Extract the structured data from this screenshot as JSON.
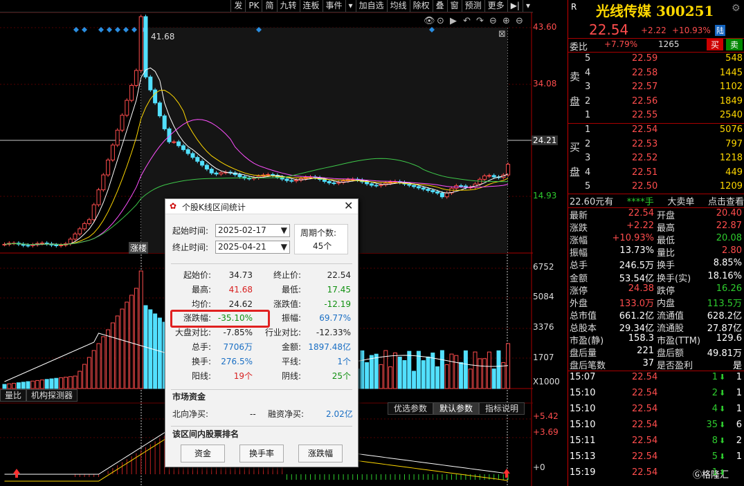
{
  "toolbar": {
    "items": [
      "发",
      "PK",
      "简",
      "九转",
      "连板",
      "事件",
      "▾",
      "加自选",
      "均线",
      "除权",
      "叠",
      "窗",
      "预测",
      "更多",
      "▶|",
      "▾"
    ]
  },
  "chart": {
    "price_axis": [
      "43.60",
      "34.08",
      "24.21",
      "14.93"
    ],
    "vol_axis": [
      "6752",
      "5084",
      "3376",
      "1707",
      "X1000"
    ],
    "ind_axis": [
      "+5.42",
      "+3.69",
      "+0"
    ],
    "peak_label": "41.68",
    "limitup_label": "涨楼",
    "subtabs": [
      "量比",
      "机构探测器"
    ],
    "param_tabs": [
      "优选参数",
      "默认参数",
      "指标说明"
    ]
  },
  "chart_data": {
    "type": "candlestick",
    "price_range": [
      9.5,
      43.6
    ],
    "marked_price": 24.21,
    "peak": 41.68
  },
  "quote": {
    "market": "R",
    "name": "光线传媒",
    "code": "300251",
    "price": "22.54",
    "change": "+2.22",
    "pct": "+10.93%",
    "tag": "陆",
    "weibi_label": "委比",
    "weibi": "+7.79%",
    "weicha": "1265",
    "buy_btn": "买",
    "sell_btn": "卖",
    "sell_side": "卖",
    "sell_side2": "盘",
    "buy_side": "买",
    "buy_side2": "盘",
    "asks": [
      {
        "lvl": "5",
        "price": "22.59",
        "vol": "548"
      },
      {
        "lvl": "4",
        "price": "22.58",
        "vol": "1445"
      },
      {
        "lvl": "3",
        "price": "22.57",
        "vol": "1102"
      },
      {
        "lvl": "2",
        "price": "22.56",
        "vol": "1849"
      },
      {
        "lvl": "1",
        "price": "22.55",
        "vol": "2540"
      }
    ],
    "bids": [
      {
        "lvl": "1",
        "price": "22.54",
        "vol": "5076"
      },
      {
        "lvl": "2",
        "price": "22.53",
        "vol": "797"
      },
      {
        "lvl": "3",
        "price": "22.52",
        "vol": "1218"
      },
      {
        "lvl": "4",
        "price": "22.51",
        "vol": "449"
      },
      {
        "lvl": "5",
        "price": "22.50",
        "vol": "1209"
      }
    ],
    "bigorder": {
      "a": "22.60元有",
      "b": "****手",
      "c": "大卖单",
      "d": "点击查看"
    },
    "stats": [
      [
        "最新",
        "22.54",
        "red",
        "开盘",
        "20.40",
        "red"
      ],
      [
        "涨跌",
        "+2.22",
        "red",
        "最高",
        "22.87",
        "red"
      ],
      [
        "涨幅",
        "+10.93%",
        "red",
        "最低",
        "20.08",
        "green"
      ],
      [
        "振幅",
        "13.73%",
        "white",
        "量比",
        "2.80",
        "red"
      ],
      [
        "总手",
        "246.5万",
        "white",
        "换手",
        "8.85%",
        "white"
      ],
      [
        "金额",
        "53.54亿",
        "white",
        "换手(实)",
        "18.16%",
        "white"
      ],
      [
        "涨停",
        "24.38",
        "red",
        "跌停",
        "16.26",
        "green"
      ],
      [
        "外盘",
        "133.0万",
        "red",
        "内盘",
        "113.5万",
        "green"
      ],
      [
        "总市值",
        "661.2亿",
        "white",
        "流通值",
        "628.2亿",
        "white"
      ],
      [
        "总股本",
        "29.34亿",
        "white",
        "流通股",
        "27.87亿",
        "white"
      ],
      [
        "市盈(静)",
        "158.3",
        "white",
        "市盈(TTM)",
        "129.6",
        "white"
      ],
      [
        "盘后量",
        "221",
        "white",
        "盘后额",
        "49.81万",
        "white"
      ],
      [
        "盘后笔数",
        "37",
        "white",
        "是否盈利",
        "是",
        "white"
      ]
    ],
    "ticks": [
      {
        "t": "15:07",
        "p": "22.54",
        "v": "1",
        "n": "1"
      },
      {
        "t": "15:10",
        "p": "22.54",
        "v": "2",
        "n": "1"
      },
      {
        "t": "15:10",
        "p": "22.54",
        "v": "4",
        "n": "1"
      },
      {
        "t": "15:10",
        "p": "22.54",
        "v": "35",
        "n": "6"
      },
      {
        "t": "15:11",
        "p": "22.54",
        "v": "8",
        "n": "2"
      },
      {
        "t": "15:13",
        "p": "22.54",
        "v": "5",
        "n": "1"
      },
      {
        "t": "15:19",
        "p": "22.54",
        "v": "1",
        "n": ""
      }
    ],
    "watermark": "格隆汇"
  },
  "dialog": {
    "title": "个股K线区间统计",
    "start_label": "起始时间:",
    "start": "2025-02-17",
    "end_label": "终止时间:",
    "end": "2025-04-21",
    "period_label": "周期个数:",
    "period": "45个",
    "rows": [
      [
        "起始价:",
        "34.73",
        "",
        "终止价:",
        "22.54",
        ""
      ],
      [
        "最高:",
        "41.68",
        "red",
        "最低:",
        "17.45",
        "green"
      ],
      [
        "均价:",
        "24.62",
        "",
        "涨跌值:",
        "-12.19",
        "green"
      ],
      [
        "涨跌幅:",
        "-35.10%",
        "green",
        "振幅:",
        "69.77%",
        "blue"
      ],
      [
        "大盘对比:",
        "-7.85%",
        "",
        "行业对比:",
        "-12.33%",
        ""
      ],
      [
        "总手:",
        "7706万",
        "blue",
        "金额:",
        "1897.48亿",
        "blue"
      ],
      [
        "换手:",
        "276.5%",
        "blue",
        "平线:",
        "1个",
        "blue"
      ],
      [
        "阳线:",
        "19个",
        "red",
        "阴线:",
        "25个",
        "green"
      ]
    ],
    "fund_title": "市场资金",
    "north_label": "北向净买:",
    "north": "--",
    "margin_label": "融资净买:",
    "margin": "2.02亿",
    "rank_title": "该区间内股票排名",
    "buttons": [
      "资金",
      "换手率",
      "涨跌幅"
    ]
  }
}
